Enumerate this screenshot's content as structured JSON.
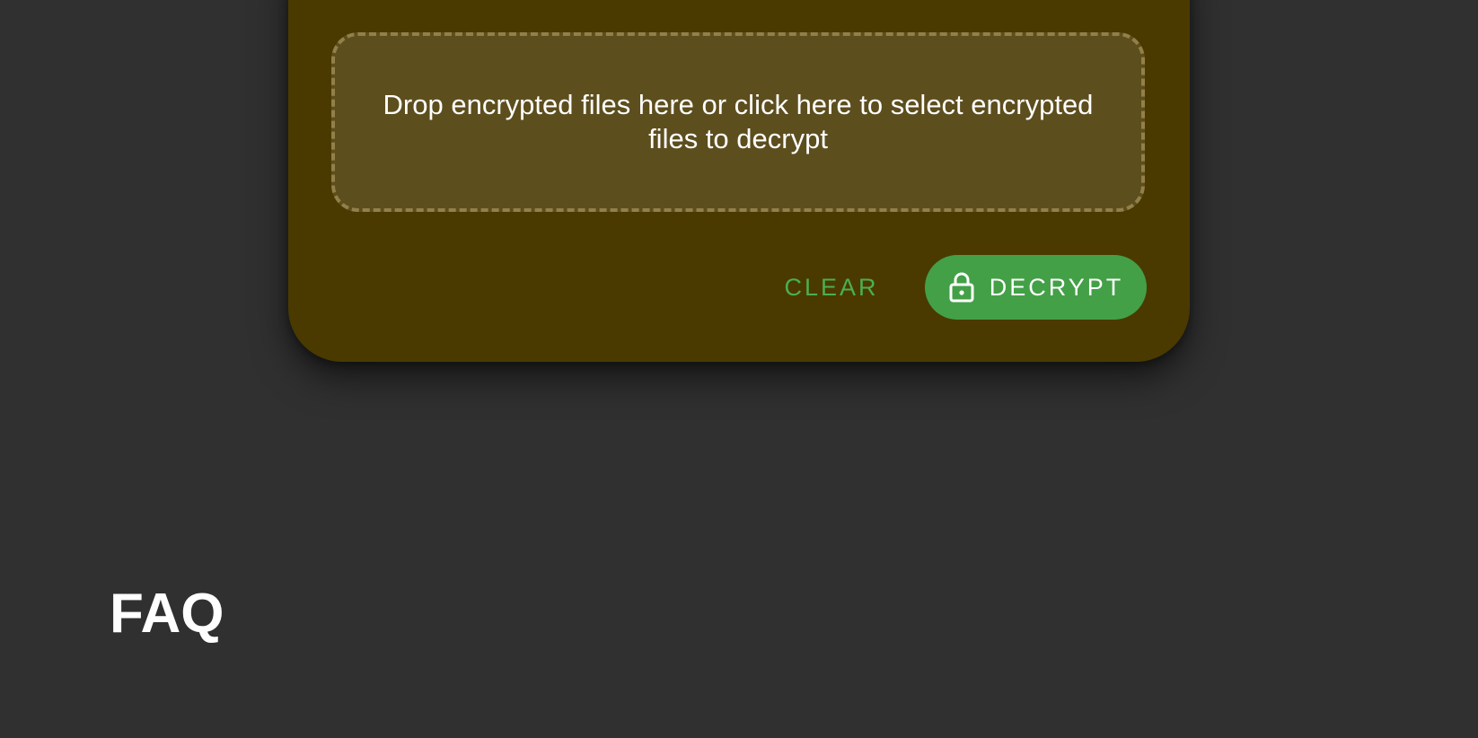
{
  "decrypt_card": {
    "dropzone_text": "Drop encrypted files here or click here to select encrypted files to decrypt",
    "clear_label": "CLEAR",
    "decrypt_label": "DECRYPT",
    "decrypt_icon": "lock-icon"
  },
  "faq": {
    "title": "FAQ"
  },
  "colors": {
    "page_background": "#303030",
    "card_background": "#4a3a00",
    "dropzone_background": "#5d4e1e",
    "accent_green": "#43a047",
    "clear_text": "#4caf50"
  }
}
